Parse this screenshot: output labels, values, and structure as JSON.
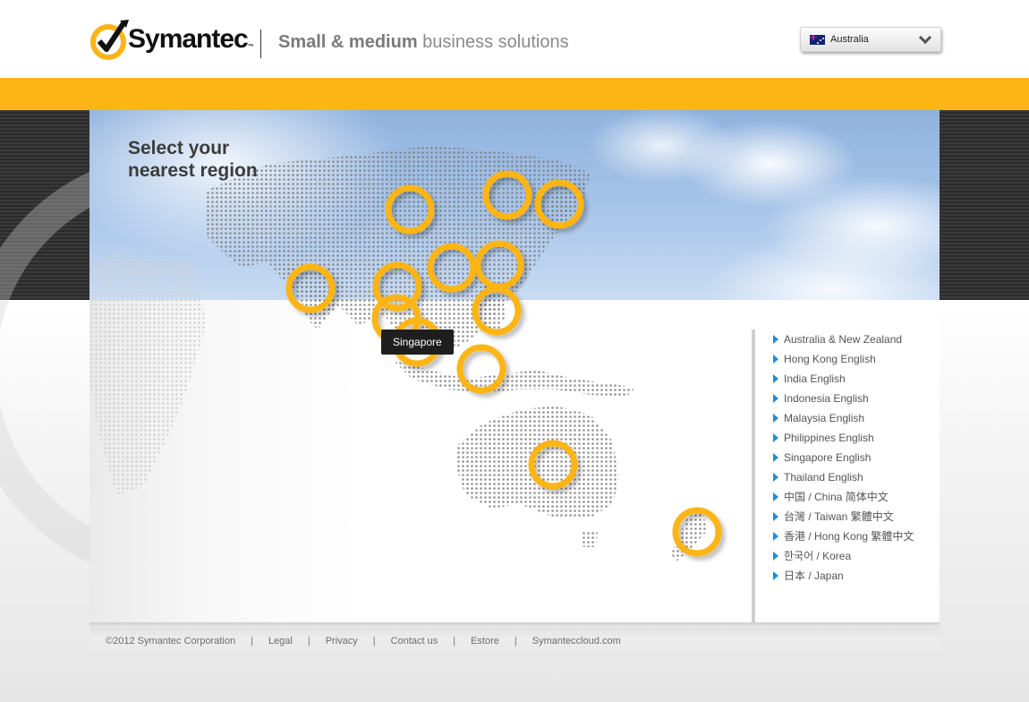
{
  "header": {
    "logo_text": "Symantec",
    "logo_tm": "™",
    "tagline_bold": "Small & medium",
    "tagline_rest": " business solutions",
    "country_selector": {
      "selected": "Australia",
      "flag_icon": "australia-flag-icon"
    }
  },
  "colors": {
    "accent_yellow": "#fdb515",
    "arrow_blue": "#1a8fd8",
    "dark_band": "#2b2b2b"
  },
  "hero": {
    "headline_line1": "Select your",
    "headline_line2": "nearest region"
  },
  "map": {
    "tooltip": "Singapore"
  },
  "regions": [
    "Australia & New Zealand",
    "Hong Kong English",
    "India English",
    "Indonesia English",
    "Malaysia English",
    "Philippines English",
    "Singapore English",
    "Thailand English",
    "中国 / China 简体中文",
    "台灣 / Taiwan 繁體中文",
    "香港 / Hong Kong 繁體中文",
    "한국어 / Korea",
    "日本 / Japan"
  ],
  "footer": {
    "copyright": "©2012 Symantec Corporation",
    "links": [
      "Legal",
      "Privacy",
      "Contact us",
      "Estore",
      "Symanteccloud.com"
    ]
  }
}
